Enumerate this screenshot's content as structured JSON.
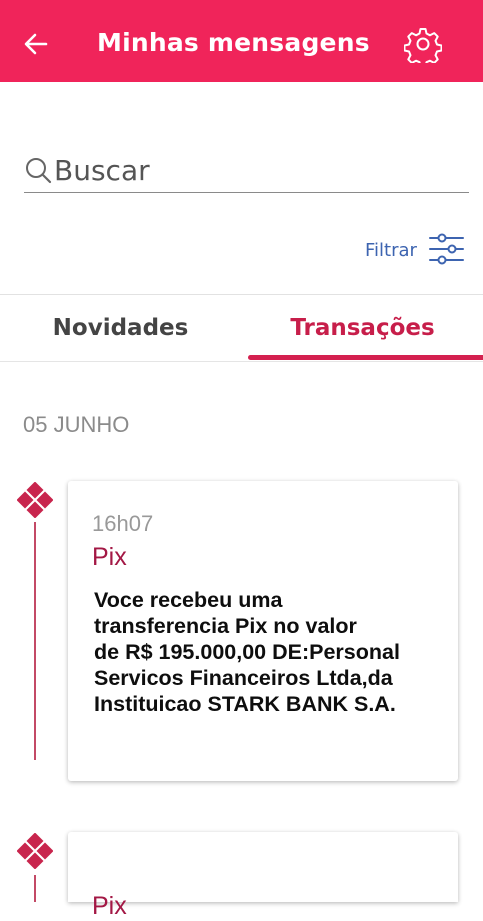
{
  "header": {
    "title": "Minhas mensagens",
    "background": "#f0245a"
  },
  "search": {
    "placeholder": "Buscar",
    "icon": "search-icon"
  },
  "filter": {
    "label": "Filtrar",
    "icon": "filter-sliders-icon"
  },
  "tabs": [
    {
      "label": "Novidades",
      "active": false
    },
    {
      "label": "Transações",
      "active": true
    }
  ],
  "feed": {
    "date": "05 JUNHO",
    "items": [
      {
        "time": "16h07",
        "kind": "Pix",
        "body": "Voce recebeu uma\ntransferencia Pix no valor\nde R$ 195.000,00 DE:Personal\nServicos Financeiros Ltda,da\nInstituicao STARK BANK S.A."
      },
      {
        "time": "",
        "kind": "Pix",
        "body": ""
      }
    ]
  },
  "colors": {
    "accent": "#f0245a",
    "active_tab": "#c71e4a",
    "timeline": "#c8254d",
    "filter_text": "#3d64b0"
  }
}
